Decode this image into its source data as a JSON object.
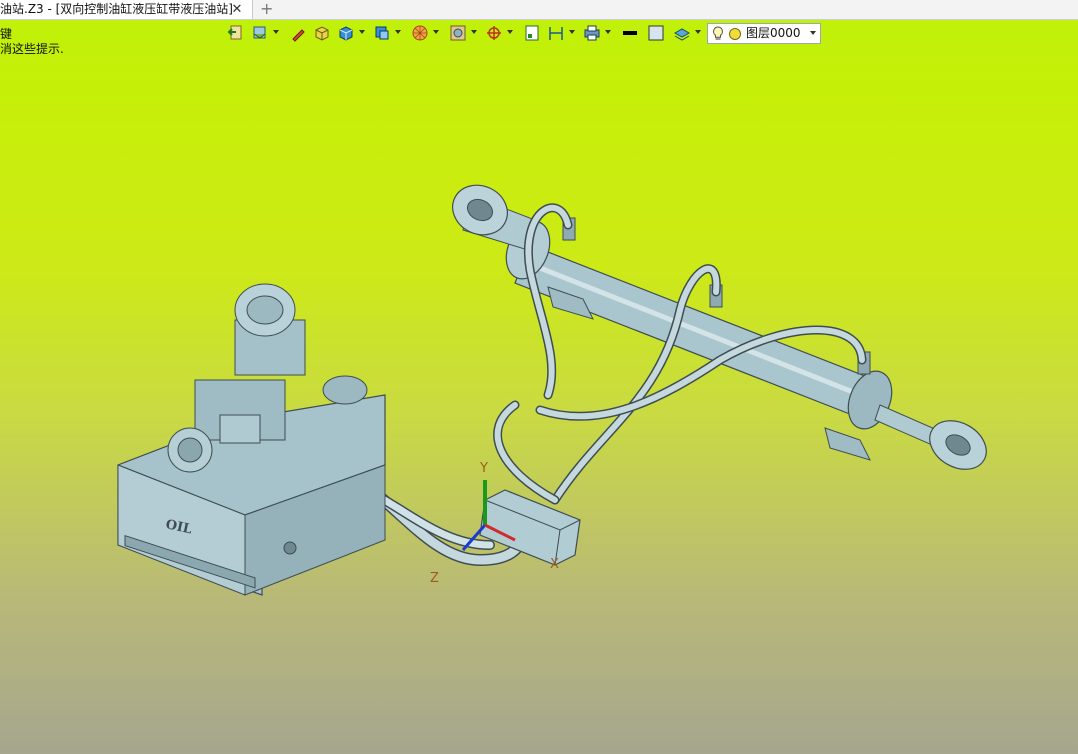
{
  "tab": {
    "title": "油站.Z3 - [双向控制油缸液压缸带液压油站]",
    "close": "✕",
    "add": "+"
  },
  "hints": {
    "line1": "键",
    "line2": "消这些提示."
  },
  "toolbar": {
    "icons": [
      "exit-icon",
      "filter-icon",
      "pen-icon",
      "box-shaded-icon",
      "box-blue-icon",
      "view-cube-icon",
      "render-sphere-icon",
      "display-mode-icon",
      "snap-icon",
      "sheet-icon",
      "dimension-icon",
      "printer-icon",
      "color-black-icon",
      "color-light-icon",
      "layer-stack-icon"
    ],
    "layer": {
      "name": "图层0000"
    }
  },
  "model": {
    "tank_label": "OIL",
    "axes": {
      "x": "X",
      "y": "Y",
      "z": "Z"
    }
  },
  "colors": {
    "part": "#a8c4cc",
    "part_dark": "#708a93",
    "hose": "#c4d8de",
    "edge": "#3e4d52"
  }
}
